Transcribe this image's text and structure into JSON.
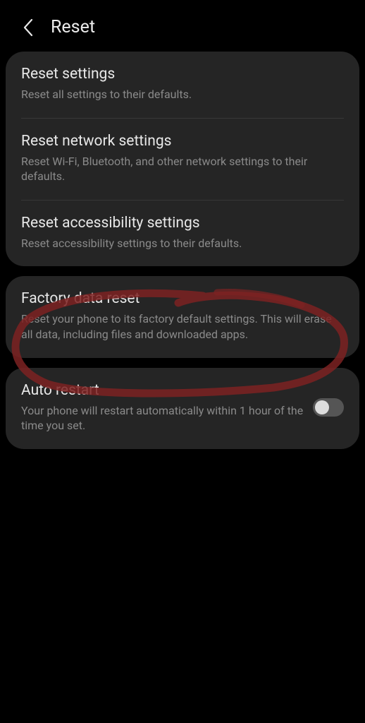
{
  "header": {
    "title": "Reset"
  },
  "group1": {
    "items": [
      {
        "title": "Reset settings",
        "desc": "Reset all settings to their defaults."
      },
      {
        "title": "Reset network settings",
        "desc": "Reset Wi-Fi, Bluetooth, and other network settings to their defaults."
      },
      {
        "title": "Reset accessibility settings",
        "desc": "Reset accessibility settings to their defaults."
      }
    ]
  },
  "group2": {
    "items": [
      {
        "title": "Factory data reset",
        "desc": "Reset your phone to its factory default settings. This will erase all data, including files and downloaded apps."
      }
    ]
  },
  "group3": {
    "items": [
      {
        "title": "Auto restart",
        "desc": "Your phone will restart automatically within 1 hour of the time you set.",
        "toggle": false
      }
    ]
  },
  "annotation": {
    "highlight": "factory-data-reset",
    "color": "#7d2222"
  }
}
